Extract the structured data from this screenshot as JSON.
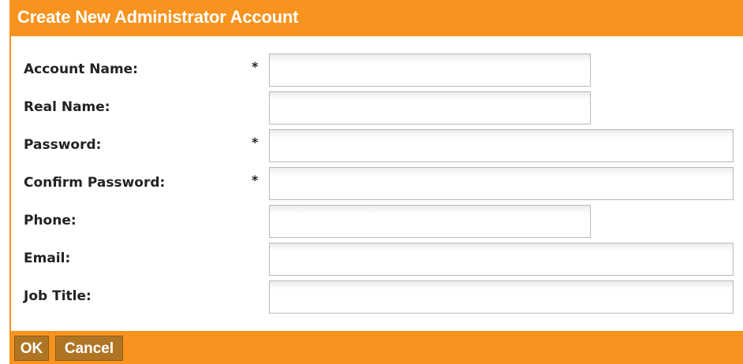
{
  "dialog": {
    "title": "Create New Administrator Account"
  },
  "form": {
    "fields": [
      {
        "label": "Account Name:",
        "required": "*",
        "value": ""
      },
      {
        "label": "Real Name:",
        "required": "",
        "value": ""
      },
      {
        "label": "Password:",
        "required": "*",
        "value": ""
      },
      {
        "label": "Confirm Password:",
        "required": "*",
        "value": ""
      },
      {
        "label": "Phone:",
        "required": "",
        "value": ""
      },
      {
        "label": "Email:",
        "required": "",
        "value": ""
      },
      {
        "label": "Job Title:",
        "required": "",
        "value": ""
      }
    ]
  },
  "buttons": {
    "ok_label": "OK",
    "cancel_label": "Cancel"
  },
  "colors": {
    "accent": "#f7931e",
    "button_bg": "#b07524"
  }
}
